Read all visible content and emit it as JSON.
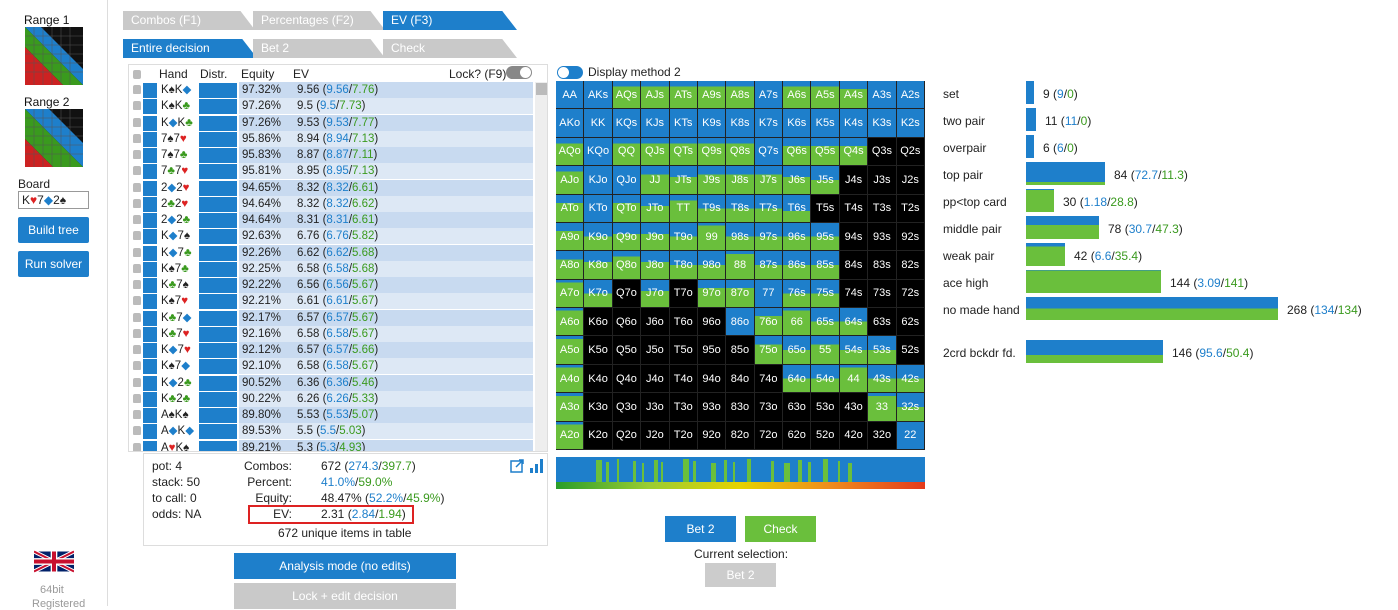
{
  "sidebar": {
    "range1_label": "Range 1",
    "range2_label": "Range 2",
    "board_label": "Board",
    "board_cards": [
      {
        "text": "K",
        "color": "#222"
      },
      {
        "text": "♥",
        "color": "#d22"
      },
      {
        "text": "7",
        "color": "#222"
      },
      {
        "text": "◆",
        "color": "#1e7fcb"
      },
      {
        "text": "2",
        "color": "#222"
      },
      {
        "text": "♠",
        "color": "#222"
      }
    ],
    "build_tree": "Build tree",
    "run_solver": "Run solver",
    "flag_icon": "uk-flag-icon",
    "bits": "64bit",
    "registered": "Registered"
  },
  "tabs_row1": [
    "Combos (F1)",
    "Percentages (F2)",
    "EV (F3)"
  ],
  "tabs_row1_active": 2,
  "tabs_row2": [
    "Entire decision",
    "Bet 2",
    "Check"
  ],
  "tabs_row2_active": 0,
  "table": {
    "headers": {
      "hand": "Hand",
      "distr": "Distr.",
      "equity": "Equity",
      "ev": "EV",
      "lock": "Lock? (F9)"
    },
    "rows": [
      {
        "hand": [
          [
            "K",
            "#222"
          ],
          [
            "♠",
            "#222"
          ],
          [
            "K",
            "#222"
          ],
          [
            "◆",
            "#1e7fcb"
          ]
        ],
        "equity": "97.32%",
        "ev": "9.56",
        "ev1": "9.56",
        "ev2": "7.76"
      },
      {
        "hand": [
          [
            "K",
            "#222"
          ],
          [
            "♠",
            "#222"
          ],
          [
            "K",
            "#222"
          ],
          [
            "♣",
            "#3a9a1e"
          ]
        ],
        "equity": "97.26%",
        "ev": "9.5",
        "ev1": "9.5",
        "ev2": "7.73"
      },
      {
        "hand": [
          [
            "K",
            "#222"
          ],
          [
            "◆",
            "#1e7fcb"
          ],
          [
            "K",
            "#222"
          ],
          [
            "♣",
            "#3a9a1e"
          ]
        ],
        "equity": "97.26%",
        "ev": "9.53",
        "ev1": "9.53",
        "ev2": "7.77"
      },
      {
        "hand": [
          [
            "7",
            "#222"
          ],
          [
            "♠",
            "#222"
          ],
          [
            "7",
            "#222"
          ],
          [
            "♥",
            "#d22"
          ]
        ],
        "equity": "95.86%",
        "ev": "8.94",
        "ev1": "8.94",
        "ev2": "7.13"
      },
      {
        "hand": [
          [
            "7",
            "#222"
          ],
          [
            "♠",
            "#222"
          ],
          [
            "7",
            "#222"
          ],
          [
            "♣",
            "#3a9a1e"
          ]
        ],
        "equity": "95.83%",
        "ev": "8.87",
        "ev1": "8.87",
        "ev2": "7.11"
      },
      {
        "hand": [
          [
            "7",
            "#222"
          ],
          [
            "♣",
            "#3a9a1e"
          ],
          [
            "7",
            "#222"
          ],
          [
            "♥",
            "#d22"
          ]
        ],
        "equity": "95.81%",
        "ev": "8.95",
        "ev1": "8.95",
        "ev2": "7.13"
      },
      {
        "hand": [
          [
            "2",
            "#222"
          ],
          [
            "◆",
            "#1e7fcb"
          ],
          [
            "2",
            "#222"
          ],
          [
            "♥",
            "#d22"
          ]
        ],
        "equity": "94.65%",
        "ev": "8.32",
        "ev1": "8.32",
        "ev2": "6.61"
      },
      {
        "hand": [
          [
            "2",
            "#222"
          ],
          [
            "♣",
            "#3a9a1e"
          ],
          [
            "2",
            "#222"
          ],
          [
            "♥",
            "#d22"
          ]
        ],
        "equity": "94.64%",
        "ev": "8.32",
        "ev1": "8.32",
        "ev2": "6.62"
      },
      {
        "hand": [
          [
            "2",
            "#222"
          ],
          [
            "◆",
            "#1e7fcb"
          ],
          [
            "2",
            "#222"
          ],
          [
            "♣",
            "#3a9a1e"
          ]
        ],
        "equity": "94.64%",
        "ev": "8.31",
        "ev1": "8.31",
        "ev2": "6.61"
      },
      {
        "hand": [
          [
            "K",
            "#222"
          ],
          [
            "◆",
            "#1e7fcb"
          ],
          [
            "7",
            "#222"
          ],
          [
            "♠",
            "#222"
          ]
        ],
        "equity": "92.63%",
        "ev": "6.76",
        "ev1": "6.76",
        "ev2": "5.82"
      },
      {
        "hand": [
          [
            "K",
            "#222"
          ],
          [
            "◆",
            "#1e7fcb"
          ],
          [
            "7",
            "#222"
          ],
          [
            "♣",
            "#3a9a1e"
          ]
        ],
        "equity": "92.26%",
        "ev": "6.62",
        "ev1": "6.62",
        "ev2": "5.68"
      },
      {
        "hand": [
          [
            "K",
            "#222"
          ],
          [
            "♠",
            "#222"
          ],
          [
            "7",
            "#222"
          ],
          [
            "♣",
            "#3a9a1e"
          ]
        ],
        "equity": "92.25%",
        "ev": "6.58",
        "ev1": "6.58",
        "ev2": "5.68"
      },
      {
        "hand": [
          [
            "K",
            "#222"
          ],
          [
            "♣",
            "#3a9a1e"
          ],
          [
            "7",
            "#222"
          ],
          [
            "♠",
            "#222"
          ]
        ],
        "equity": "92.22%",
        "ev": "6.56",
        "ev1": "6.56",
        "ev2": "5.67"
      },
      {
        "hand": [
          [
            "K",
            "#222"
          ],
          [
            "♠",
            "#222"
          ],
          [
            "7",
            "#222"
          ],
          [
            "♥",
            "#d22"
          ]
        ],
        "equity": "92.21%",
        "ev": "6.61",
        "ev1": "6.61",
        "ev2": "5.67"
      },
      {
        "hand": [
          [
            "K",
            "#222"
          ],
          [
            "♣",
            "#3a9a1e"
          ],
          [
            "7",
            "#222"
          ],
          [
            "◆",
            "#1e7fcb"
          ]
        ],
        "equity": "92.17%",
        "ev": "6.57",
        "ev1": "6.57",
        "ev2": "5.67"
      },
      {
        "hand": [
          [
            "K",
            "#222"
          ],
          [
            "♣",
            "#3a9a1e"
          ],
          [
            "7",
            "#222"
          ],
          [
            "♥",
            "#d22"
          ]
        ],
        "equity": "92.16%",
        "ev": "6.58",
        "ev1": "6.58",
        "ev2": "5.67"
      },
      {
        "hand": [
          [
            "K",
            "#222"
          ],
          [
            "◆",
            "#1e7fcb"
          ],
          [
            "7",
            "#222"
          ],
          [
            "♥",
            "#d22"
          ]
        ],
        "equity": "92.12%",
        "ev": "6.57",
        "ev1": "6.57",
        "ev2": "5.66"
      },
      {
        "hand": [
          [
            "K",
            "#222"
          ],
          [
            "♠",
            "#222"
          ],
          [
            "7",
            "#222"
          ],
          [
            "◆",
            "#1e7fcb"
          ]
        ],
        "equity": "92.10%",
        "ev": "6.58",
        "ev1": "6.58",
        "ev2": "5.67"
      },
      {
        "hand": [
          [
            "K",
            "#222"
          ],
          [
            "◆",
            "#1e7fcb"
          ],
          [
            "2",
            "#222"
          ],
          [
            "♣",
            "#3a9a1e"
          ]
        ],
        "equity": "90.52%",
        "ev": "6.36",
        "ev1": "6.36",
        "ev2": "5.46"
      },
      {
        "hand": [
          [
            "K",
            "#222"
          ],
          [
            "♣",
            "#3a9a1e"
          ],
          [
            "2",
            "#222"
          ],
          [
            "♣",
            "#3a9a1e"
          ]
        ],
        "equity": "90.22%",
        "ev": "6.26",
        "ev1": "6.26",
        "ev2": "5.33"
      },
      {
        "hand": [
          [
            "A",
            "#222"
          ],
          [
            "♠",
            "#222"
          ],
          [
            "K",
            "#222"
          ],
          [
            "♠",
            "#222"
          ]
        ],
        "equity": "89.80%",
        "ev": "5.53",
        "ev1": "5.53",
        "ev2": "5.07"
      },
      {
        "hand": [
          [
            "A",
            "#222"
          ],
          [
            "◆",
            "#1e7fcb"
          ],
          [
            "K",
            "#222"
          ],
          [
            "◆",
            "#1e7fcb"
          ]
        ],
        "equity": "89.53%",
        "ev": "5.5",
        "ev1": "5.5",
        "ev2": "5.03"
      },
      {
        "hand": [
          [
            "A",
            "#222"
          ],
          [
            "♥",
            "#d22"
          ],
          [
            "K",
            "#222"
          ],
          [
            "♠",
            "#222"
          ]
        ],
        "equity": "89.21%",
        "ev": "5.3",
        "ev1": "5.3",
        "ev2": "4.93"
      }
    ]
  },
  "summary": {
    "pot": "pot: 4",
    "stack": "stack: 50",
    "to_call": "to call: 0",
    "odds": "odds: NA",
    "combos_label": "Combos:",
    "combos": "672",
    "combos_b": "274.3",
    "combos_g": "397.7",
    "percent_label": "Percent:",
    "percent_b": "41.0%",
    "percent_g": "59.0%",
    "equity_label": "Equity:",
    "equity": "48.47%",
    "equity_b": "52.2%",
    "equity_g": "45.9%",
    "ev_label": "EV:",
    "ev": "2.31",
    "ev_b": "2.84",
    "ev_g": "1.94",
    "unique": "672 unique items in table"
  },
  "buttons": {
    "analysis_mode": "Analysis mode (no edits)",
    "lock_edit": "Lock + edit decision",
    "bet2": "Bet 2",
    "check": "Check",
    "current_selection": "Current selection:",
    "selected": "Bet 2"
  },
  "display_method": "Display method 2",
  "grid": {
    "hands": [
      [
        "AA",
        "AKs",
        "AQs",
        "AJs",
        "ATs",
        "A9s",
        "A8s",
        "A7s",
        "A6s",
        "A5s",
        "A4s",
        "A3s",
        "A2s"
      ],
      [
        "AKo",
        "KK",
        "KQs",
        "KJs",
        "KTs",
        "K9s",
        "K8s",
        "K7s",
        "K6s",
        "K5s",
        "K4s",
        "K3s",
        "K2s"
      ],
      [
        "AQo",
        "KQo",
        "QQ",
        "QJs",
        "QTs",
        "Q9s",
        "Q8s",
        "Q7s",
        "Q6s",
        "Q5s",
        "Q4s",
        "Q3s",
        "Q2s"
      ],
      [
        "AJo",
        "KJo",
        "QJo",
        "JJ",
        "JTs",
        "J9s",
        "J8s",
        "J7s",
        "J6s",
        "J5s",
        "J4s",
        "J3s",
        "J2s"
      ],
      [
        "ATo",
        "KTo",
        "QTo",
        "JTo",
        "TT",
        "T9s",
        "T8s",
        "T7s",
        "T6s",
        "T5s",
        "T4s",
        "T3s",
        "T2s"
      ],
      [
        "A9o",
        "K9o",
        "Q9o",
        "J9o",
        "T9o",
        "99",
        "98s",
        "97s",
        "96s",
        "95s",
        "94s",
        "93s",
        "92s"
      ],
      [
        "A8o",
        "K8o",
        "Q8o",
        "J8o",
        "T8o",
        "98o",
        "88",
        "87s",
        "86s",
        "85s",
        "84s",
        "83s",
        "82s"
      ],
      [
        "A7o",
        "K7o",
        "Q7o",
        "J7o",
        "T7o",
        "97o",
        "87o",
        "77",
        "76s",
        "75s",
        "74s",
        "73s",
        "72s"
      ],
      [
        "A6o",
        "K6o",
        "Q6o",
        "J6o",
        "T6o",
        "96o",
        "86o",
        "76o",
        "66",
        "65s",
        "64s",
        "63s",
        "62s"
      ],
      [
        "A5o",
        "K5o",
        "Q5o",
        "J5o",
        "T5o",
        "95o",
        "85o",
        "75o",
        "65o",
        "55",
        "54s",
        "53s",
        "52s"
      ],
      [
        "A4o",
        "K4o",
        "Q4o",
        "J4o",
        "T4o",
        "94o",
        "84o",
        "74o",
        "64o",
        "54o",
        "44",
        "43s",
        "42s"
      ],
      [
        "A3o",
        "K3o",
        "Q3o",
        "J3o",
        "T3o",
        "93o",
        "83o",
        "73o",
        "63o",
        "53o",
        "43o",
        "33",
        "32s"
      ],
      [
        "A2o",
        "K2o",
        "Q2o",
        "J2o",
        "T2o",
        "92o",
        "82o",
        "72o",
        "62o",
        "52o",
        "42o",
        "32o",
        "22"
      ]
    ],
    "bet_fraction": [
      [
        1,
        1,
        0.2,
        0.2,
        0.2,
        0.2,
        0.2,
        1,
        0.2,
        0.2,
        0.3,
        1,
        1
      ],
      [
        1,
        1,
        1,
        1,
        1,
        1,
        1,
        1,
        1,
        1,
        1,
        1,
        1
      ],
      [
        0.2,
        1,
        0.2,
        0.2,
        0.2,
        0.2,
        0.2,
        1,
        0.3,
        0.3,
        0.3,
        -1,
        -1
      ],
      [
        0.2,
        1,
        1,
        0.3,
        0.4,
        0.3,
        0.3,
        0.3,
        0.4,
        0.5,
        -1,
        -1,
        -1
      ],
      [
        0.3,
        1,
        0.3,
        0.4,
        0.2,
        0.5,
        0.5,
        0.5,
        0.6,
        -1,
        -1,
        -1,
        -1
      ],
      [
        0.3,
        0.5,
        0.4,
        0.4,
        0.5,
        0.1,
        0.5,
        0.5,
        0.5,
        0.5,
        -1,
        -1,
        -1
      ],
      [
        0.3,
        0.4,
        0.2,
        0.4,
        0.5,
        0.5,
        0.1,
        0.5,
        0.5,
        0.5,
        -1,
        -1,
        -1
      ],
      [
        0.1,
        0.5,
        -1,
        0.4,
        -1,
        0.3,
        0.3,
        1,
        0.5,
        0.5,
        -1,
        -1,
        -1
      ],
      [
        0.1,
        -1,
        -1,
        -1,
        -1,
        -1,
        1,
        0.3,
        0.1,
        0.5,
        0.5,
        -1,
        -1
      ],
      [
        0.1,
        -1,
        -1,
        -1,
        -1,
        -1,
        -1,
        0.3,
        0.5,
        0.3,
        0.5,
        0.5,
        -1
      ],
      [
        0.1,
        -1,
        -1,
        -1,
        -1,
        -1,
        -1,
        -1,
        0.5,
        0.5,
        0.1,
        0.5,
        0.5
      ],
      [
        0.1,
        -1,
        -1,
        -1,
        -1,
        -1,
        -1,
        -1,
        -1,
        -1,
        -1,
        0.1,
        0.5
      ],
      [
        0.1,
        -1,
        -1,
        -1,
        -1,
        -1,
        -1,
        -1,
        -1,
        -1,
        -1,
        -1,
        1
      ]
    ],
    "bet_color": "#1e7fcb",
    "check_color": "#6abf3c",
    "empty_color": "#000000"
  },
  "categories": [
    {
      "name": "set",
      "total": "9",
      "b": "9",
      "g": "0",
      "fraction_bet": 1.0
    },
    {
      "name": "two pair",
      "total": "11",
      "b": "11",
      "g": "0",
      "fraction_bet": 1.0
    },
    {
      "name": "overpair",
      "total": "6",
      "b": "6",
      "g": "0",
      "fraction_bet": 1.0
    },
    {
      "name": "top pair",
      "total": "84",
      "b": "72.7",
      "g": "11.3",
      "fraction_bet": 0.87
    },
    {
      "name": "pp<top card",
      "total": "30",
      "b": "1.18",
      "g": "28.8",
      "fraction_bet": 0.04
    },
    {
      "name": "middle pair",
      "total": "78",
      "b": "30.7",
      "g": "47.3",
      "fraction_bet": 0.39
    },
    {
      "name": "weak pair",
      "total": "42",
      "b": "6.6",
      "g": "35.4",
      "fraction_bet": 0.16
    },
    {
      "name": "ace high",
      "total": "144",
      "b": "3.09",
      "g": "141",
      "fraction_bet": 0.02
    },
    {
      "name": "no made hand",
      "total": "268",
      "b": "134",
      "g": "134",
      "fraction_bet": 0.5
    },
    {
      "name": "2crd bckdr fd.",
      "total": "146",
      "b": "95.6",
      "g": "50.4",
      "fraction_bet": 0.65
    }
  ]
}
